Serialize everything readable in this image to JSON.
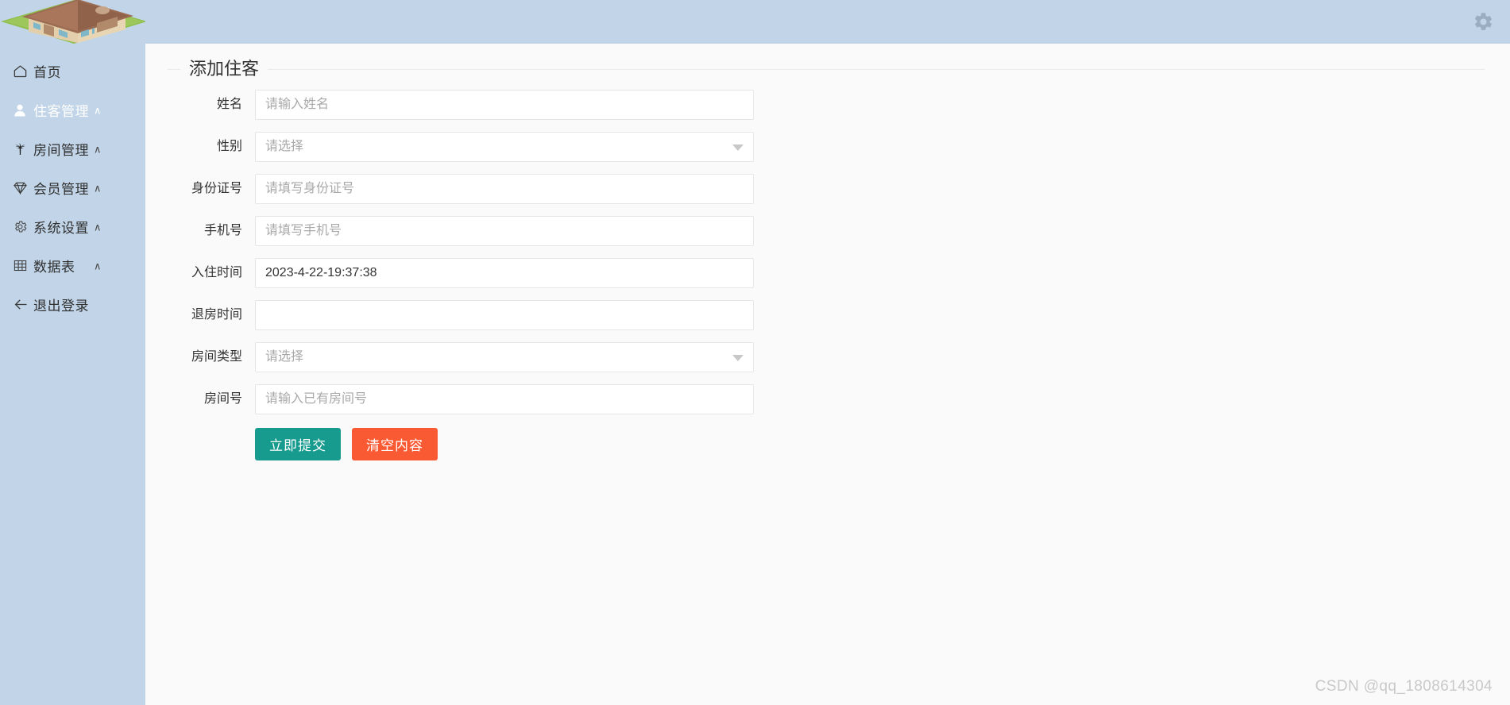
{
  "header": {
    "gear_icon": "gear-icon",
    "bg_color": "#c2d5e8"
  },
  "sidebar": {
    "logo_alt": "hotel-house-logo",
    "bg_color": "#c2d5e8",
    "items": [
      {
        "label": "首页",
        "icon": "home-icon",
        "has_chevron": false,
        "active": false
      },
      {
        "label": "住客管理",
        "icon": "user-icon",
        "has_chevron": true,
        "active": true,
        "chevron": "∧"
      },
      {
        "label": "房间管理",
        "icon": "bed-icon",
        "has_chevron": true,
        "active": false,
        "chevron": "∧"
      },
      {
        "label": "会员管理",
        "icon": "diamond-icon",
        "has_chevron": true,
        "active": false,
        "chevron": "∧"
      },
      {
        "label": "系统设置",
        "icon": "gear-icon",
        "has_chevron": true,
        "active": false,
        "chevron": "∧"
      },
      {
        "label": "数据表",
        "icon": "table-icon",
        "has_chevron": true,
        "active": false,
        "chevron": "∧"
      },
      {
        "label": "退出登录",
        "icon": "arrow-left-icon",
        "has_chevron": false,
        "active": false
      }
    ]
  },
  "main": {
    "legend": "添加住客",
    "fields": [
      {
        "label": "姓名",
        "type": "text",
        "value": "",
        "placeholder": "请输入姓名"
      },
      {
        "label": "性别",
        "type": "select",
        "value": "请选择",
        "placeholder": "请选择"
      },
      {
        "label": "身份证号",
        "type": "text",
        "value": "",
        "placeholder": "请填写身份证号"
      },
      {
        "label": "手机号",
        "type": "text",
        "value": "",
        "placeholder": "请填写手机号"
      },
      {
        "label": "入住时间",
        "type": "text",
        "value": "2023-4-22-19:37:38",
        "placeholder": ""
      },
      {
        "label": "退房时间",
        "type": "text",
        "value": "",
        "placeholder": ""
      },
      {
        "label": "房间类型",
        "type": "select",
        "value": "请选择",
        "placeholder": "请选择"
      },
      {
        "label": "房间号",
        "type": "text",
        "value": "",
        "placeholder": "请输入已有房间号"
      }
    ],
    "submit_label": "立即提交",
    "reset_label": "清空内容",
    "submit_color": "#179b8e",
    "reset_color": "#fa5a33"
  },
  "watermark": "CSDN @qq_1808614304"
}
